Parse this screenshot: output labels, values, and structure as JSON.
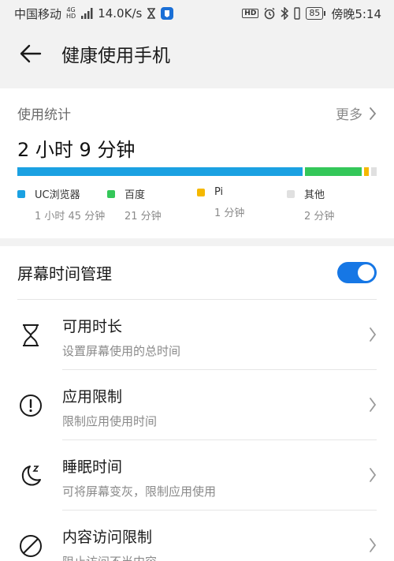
{
  "status_bar": {
    "carrier": "中国移动",
    "network_sup": "4G",
    "network_sub": "HD",
    "speed": "14.0K/s",
    "hd": "HD",
    "battery": "85",
    "time": "傍晚5:14"
  },
  "appbar": {
    "title": "健康使用手机"
  },
  "usage": {
    "label": "使用统计",
    "more": "更多",
    "total": "2 小时 9 分钟",
    "apps": [
      {
        "name": "UC浏览器",
        "time": "1 小时 45 分钟",
        "minutes": 105,
        "color": "#1ba1e2"
      },
      {
        "name": "百度",
        "time": "21 分钟",
        "minutes": 21,
        "color": "#34c759"
      },
      {
        "name": "Pi",
        "time": "1 分钟",
        "minutes": 1,
        "color": "#f5b800"
      },
      {
        "name": "其他",
        "time": "2 分钟",
        "minutes": 2,
        "color": "#e0e0e0"
      }
    ]
  },
  "screen_time": {
    "label": "屏幕时间管理",
    "enabled": true,
    "items": [
      {
        "icon": "hourglass-icon",
        "title": "可用时长",
        "subtitle": "设置屏幕使用的总时间"
      },
      {
        "icon": "alert-circle-icon",
        "title": "应用限制",
        "subtitle": "限制应用使用时间"
      },
      {
        "icon": "moon-sleep-icon",
        "title": "睡眠时间",
        "subtitle": "可将屏幕变灰，限制应用使用"
      },
      {
        "icon": "block-icon",
        "title": "内容访问限制",
        "subtitle": "阻止访问不当内容"
      }
    ]
  }
}
